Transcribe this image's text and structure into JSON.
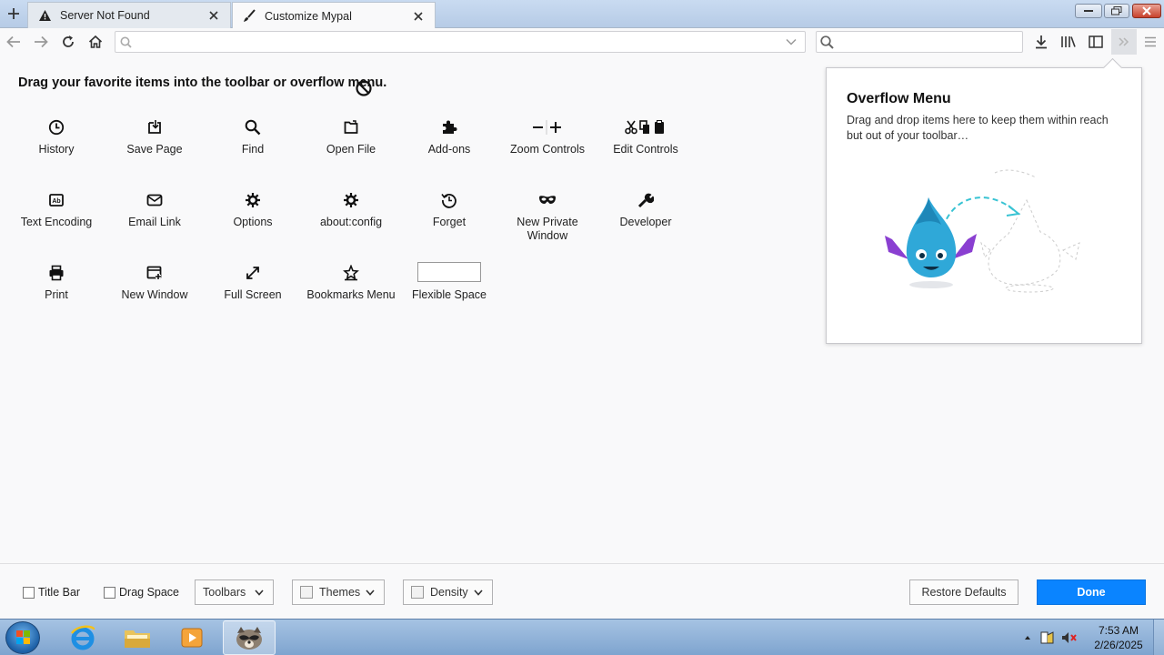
{
  "tabs": [
    {
      "label": "Server Not Found",
      "icon": "warning-icon"
    },
    {
      "label": "Customize Mypal",
      "icon": "paintbrush-icon"
    }
  ],
  "navbar": {
    "url_value": "",
    "search_value": ""
  },
  "palette": {
    "heading": "Drag your favorite items into the toolbar or overflow menu.",
    "items": [
      {
        "label": "History",
        "icon": "clock-icon"
      },
      {
        "label": "Save Page",
        "icon": "save-page-icon"
      },
      {
        "label": "Find",
        "icon": "search-icon"
      },
      {
        "label": "Open File",
        "icon": "open-file-icon"
      },
      {
        "label": "Add-ons",
        "icon": "puzzle-icon"
      },
      {
        "label": "Zoom Controls",
        "icon": "zoom-icon"
      },
      {
        "label": "Edit Controls",
        "icon": "edit-controls-icon"
      },
      {
        "label": "Text Encoding",
        "icon": "text-encoding-icon"
      },
      {
        "label": "Email Link",
        "icon": "email-icon"
      },
      {
        "label": "Options",
        "icon": "gear-icon"
      },
      {
        "label": "about:config",
        "icon": "gear-icon"
      },
      {
        "label": "Forget",
        "icon": "forget-icon"
      },
      {
        "label": "New Private Window",
        "icon": "mask-icon"
      },
      {
        "label": "Developer",
        "icon": "wrench-icon"
      },
      {
        "label": "Print",
        "icon": "printer-icon"
      },
      {
        "label": "New Window",
        "icon": "new-window-icon"
      },
      {
        "label": "Full Screen",
        "icon": "fullscreen-icon"
      },
      {
        "label": "Bookmarks Menu",
        "icon": "bookmark-star-icon"
      },
      {
        "label": "Flexible Space",
        "icon": "flexible-space-box"
      }
    ]
  },
  "overflow": {
    "title": "Overflow Menu",
    "description": "Drag and drop items here to keep them within reach but out of your toolbar…"
  },
  "footer": {
    "title_bar": "Title Bar",
    "drag_space": "Drag Space",
    "toolbars": "Toolbars",
    "themes": "Themes",
    "density": "Density",
    "restore": "Restore Defaults",
    "done": "Done"
  },
  "taskbar": {
    "time": "7:53 AM",
    "date": "2/26/2025"
  },
  "colors": {
    "accent": "#0a84ff",
    "mascot": "#2fa8d8",
    "mascot_horns": "#8a3fd1"
  }
}
